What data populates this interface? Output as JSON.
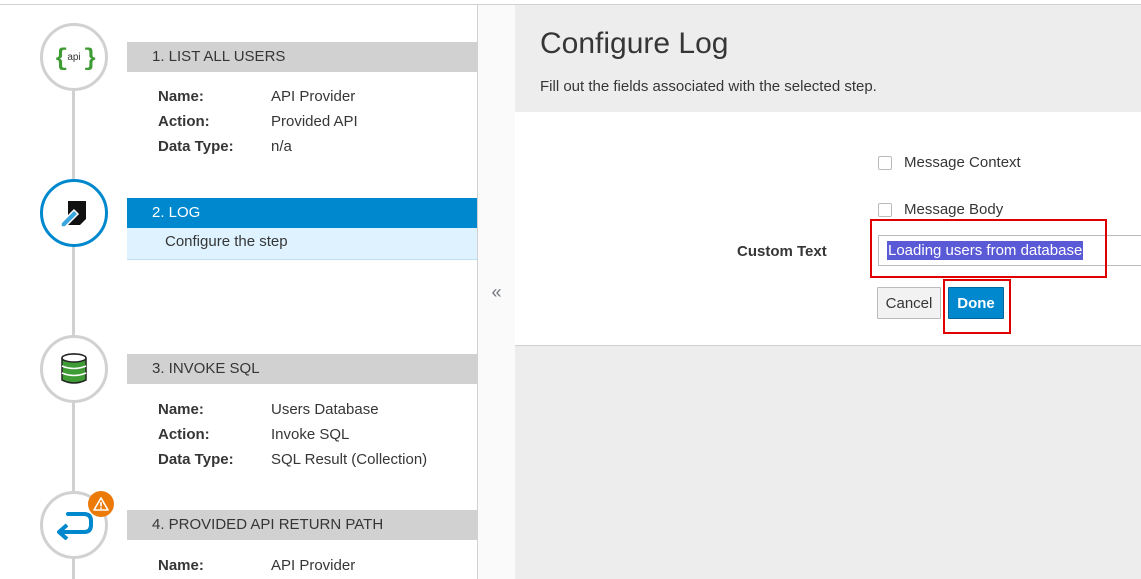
{
  "flow": {
    "steps": [
      {
        "title": "1. LIST ALL USERS",
        "icon": "api-icon",
        "icon_text": "api",
        "details": [
          {
            "key": "Name:",
            "value": "API Provider"
          },
          {
            "key": "Action:",
            "value": "Provided API"
          },
          {
            "key": "Data Type:",
            "value": "n/a"
          }
        ]
      },
      {
        "title": "2. LOG",
        "icon": "log-edit-icon",
        "subtitle": "Configure the step",
        "active": true
      },
      {
        "title": "3. INVOKE SQL",
        "icon": "database-icon",
        "details": [
          {
            "key": "Name:",
            "value": "Users Database"
          },
          {
            "key": "Action:",
            "value": "Invoke SQL"
          },
          {
            "key": "Data Type:",
            "value": "SQL Result (Collection)"
          }
        ]
      },
      {
        "title": "4. PROVIDED API RETURN PATH",
        "icon": "return-arrow-icon",
        "warning_icon": "warning-icon",
        "details": [
          {
            "key": "Name:",
            "value": "API Provider"
          }
        ]
      }
    ],
    "collapse_label": "«"
  },
  "config": {
    "title": "Configure Log",
    "description": "Fill out the fields associated with the selected step.",
    "message_context_label": "Message Context",
    "message_body_label": "Message Body",
    "custom_text_label": "Custom Text",
    "custom_text_value": "Loading users from database",
    "cancel_label": "Cancel",
    "done_label": "Done"
  },
  "colors": {
    "accent": "#0088ce",
    "active_sub_bg": "#def3ff",
    "step_header_bg": "#d1d1d1",
    "warning": "#ec7a08",
    "highlight_box": "#e00000",
    "selection": "#5a5ad6"
  }
}
